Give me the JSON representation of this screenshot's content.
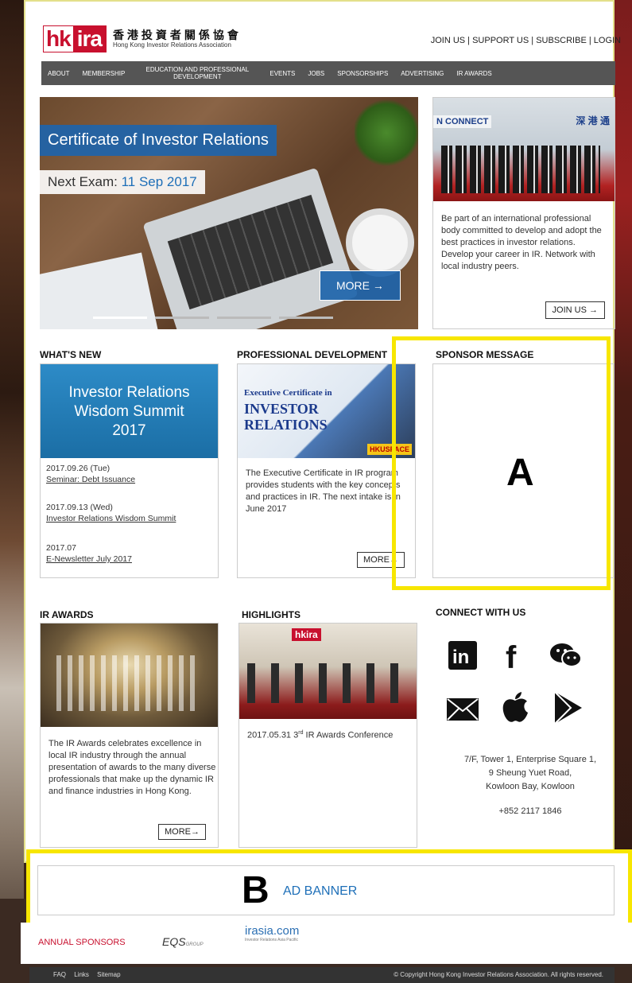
{
  "header": {
    "logo_hk": "hk",
    "logo_ira": "ira",
    "logo_cn": "香港投資者關係協會",
    "logo_en": "Hong Kong Investor Relations Association",
    "top_links": [
      "JOIN US",
      "SUPPORT US",
      "SUBSCRIBE",
      "LOGIN"
    ]
  },
  "nav": {
    "items": [
      "ABOUT",
      "MEMBERSHIP",
      "EDUCATION AND PROFESSIONAL DEVELOPMENT",
      "EVENTS",
      "JOBS",
      "SPONSORSHIPS",
      "ADVERTISING",
      "IR AWARDS"
    ]
  },
  "hero": {
    "title": "Certificate of Investor Relations",
    "exam_prefix": "Next Exam: ",
    "exam_date": "11 Sep 2017",
    "more": "MORE →"
  },
  "promo": {
    "photo_label": "N CONNECT",
    "photo_cn": "深 港 通",
    "text": "Be part of an international professional body committed to develop and adopt the best practices in investor relations. Develop your career in IR. Network with local industry peers.",
    "join": "JOIN US →"
  },
  "whats_new": {
    "title": "WHAT'S NEW",
    "banner": [
      "Investor Relations",
      "Wisdom Summit",
      "2017"
    ],
    "items": [
      {
        "date": "2017.09.26 (Tue)",
        "title": "Seminar: Debt Issuance"
      },
      {
        "date": "2017.09.13 (Wed)",
        "title": "Investor Relations Wisdom Summit"
      },
      {
        "date": "2017.07",
        "title": "E-Newsletter July 2017"
      }
    ]
  },
  "prof_dev": {
    "title": "PROFESSIONAL DEVELOPMENT",
    "banner_small": "Executive Certificate in",
    "banner_big": "INVESTOR RELATIONS",
    "hku": "HKUSPACE",
    "text": "The Executive Certificate in IR program provides students with the key concepts and practices in IR. The next intake is in June 2017",
    "more": "MORE→"
  },
  "sponsor": {
    "title": "SPONSOR MESSAGE",
    "marker": "A"
  },
  "ir_awards": {
    "title": "IR AWARDS",
    "text": "The IR Awards celebrates excellence in local IR industry through the annual presentation of awards to the many diverse professionals that make up the dynamic IR and finance industries in Hong Kong.",
    "more": "MORE→"
  },
  "highlights": {
    "title": "HIGHLIGHTS",
    "caption_pre": "2017.05.31 ",
    "caption_num": "3",
    "caption_sup": "rd",
    "caption_post": " IR Awards Conference"
  },
  "connect": {
    "title": "CONNECT WITH US",
    "icons": [
      "linkedin-icon",
      "facebook-icon",
      "wechat-icon",
      "email-icon",
      "apple-icon",
      "google-play-icon"
    ],
    "address": [
      "7/F, Tower 1, Enterprise Square 1,",
      "9 Sheung Yuet Road,",
      "Kowloon Bay, Kowloon"
    ],
    "phone": "+852 2117 1846"
  },
  "ad": {
    "marker": "B",
    "text": "AD BANNER"
  },
  "sponsors_bar": {
    "label": "ANNUAL SPONSORS",
    "eqs": "EQS",
    "eqs_sub": "GROUP",
    "irasia": "irasia.com",
    "irasia_sub": "Investor Relations Asia Pacific"
  },
  "footer": {
    "links": [
      "FAQ",
      "Links",
      "Sitemap"
    ],
    "copyright": "© Copyright Hong Kong Investor Relations Association. All rights reserved."
  },
  "colors": {
    "brand_red": "#c8102e",
    "accent_blue": "#1e6fb8",
    "highlight_yellow": "#f7e600",
    "nav_gray": "#555555"
  }
}
